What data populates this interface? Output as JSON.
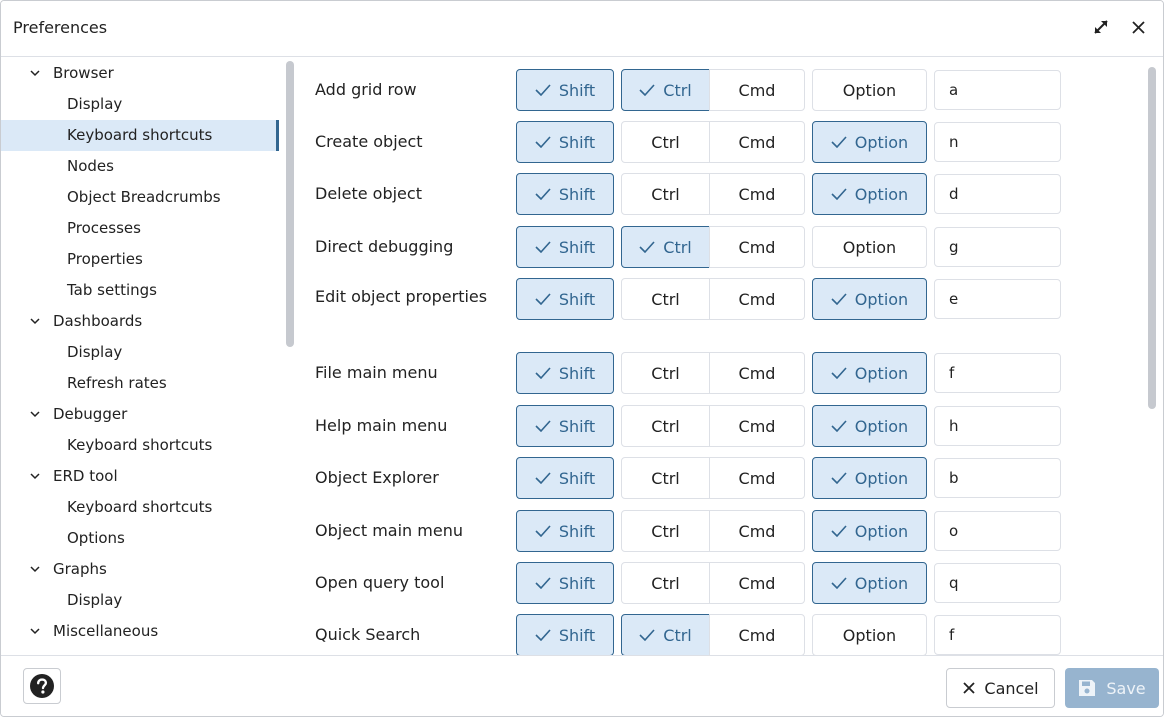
{
  "dialog": {
    "title": "Preferences",
    "expand_icon": "expand-arrows-icon",
    "close_icon": "close-icon"
  },
  "sidebar": {
    "rows": [
      {
        "label": "Browser",
        "type": "group",
        "expanded": true
      },
      {
        "label": "Display",
        "type": "child"
      },
      {
        "label": "Keyboard shortcuts",
        "type": "child",
        "selected": true
      },
      {
        "label": "Nodes",
        "type": "child"
      },
      {
        "label": "Object Breadcrumbs",
        "type": "child"
      },
      {
        "label": "Processes",
        "type": "child"
      },
      {
        "label": "Properties",
        "type": "child"
      },
      {
        "label": "Tab settings",
        "type": "child"
      },
      {
        "label": "Dashboards",
        "type": "group",
        "expanded": true
      },
      {
        "label": "Display",
        "type": "child"
      },
      {
        "label": "Refresh rates",
        "type": "child"
      },
      {
        "label": "Debugger",
        "type": "group",
        "expanded": true
      },
      {
        "label": "Keyboard shortcuts",
        "type": "child"
      },
      {
        "label": "ERD tool",
        "type": "group",
        "expanded": true
      },
      {
        "label": "Keyboard shortcuts",
        "type": "child"
      },
      {
        "label": "Options",
        "type": "child"
      },
      {
        "label": "Graphs",
        "type": "group",
        "expanded": true
      },
      {
        "label": "Display",
        "type": "child"
      },
      {
        "label": "Miscellaneous",
        "type": "group",
        "expanded": true
      }
    ]
  },
  "modifier_labels": {
    "shift": "Shift",
    "ctrl": "Ctrl",
    "cmd": "Cmd",
    "option": "Option"
  },
  "shortcuts": [
    {
      "label": "Add grid row",
      "shift": true,
      "ctrl": true,
      "cmd": false,
      "option": false,
      "key": "a"
    },
    {
      "label": "Create object",
      "shift": true,
      "ctrl": false,
      "cmd": false,
      "option": true,
      "key": "n"
    },
    {
      "label": "Delete object",
      "shift": true,
      "ctrl": false,
      "cmd": false,
      "option": true,
      "key": "d"
    },
    {
      "label": "Direct debugging",
      "shift": true,
      "ctrl": true,
      "cmd": false,
      "option": false,
      "key": "g"
    },
    {
      "label": "Edit object properties",
      "shift": true,
      "ctrl": false,
      "cmd": false,
      "option": true,
      "key": "e"
    },
    {
      "label": "File main menu",
      "shift": true,
      "ctrl": false,
      "cmd": false,
      "option": true,
      "key": "f"
    },
    {
      "label": "Help main menu",
      "shift": true,
      "ctrl": false,
      "cmd": false,
      "option": true,
      "key": "h"
    },
    {
      "label": "Object Explorer",
      "shift": true,
      "ctrl": false,
      "cmd": false,
      "option": true,
      "key": "b"
    },
    {
      "label": "Object main menu",
      "shift": true,
      "ctrl": false,
      "cmd": false,
      "option": true,
      "key": "o"
    },
    {
      "label": "Open query tool",
      "shift": true,
      "ctrl": false,
      "cmd": false,
      "option": true,
      "key": "q"
    },
    {
      "label": "Quick Search",
      "shift": true,
      "ctrl": true,
      "cmd": false,
      "option": false,
      "key": "f"
    }
  ],
  "footer": {
    "help_icon": "question-circle-icon",
    "cancel_label": "Cancel",
    "save_label": "Save",
    "save_enabled": false
  },
  "colors": {
    "accent": "#326690",
    "selected_bg": "#dbe9f7",
    "save_disabled_bg": "#97b4cf"
  }
}
